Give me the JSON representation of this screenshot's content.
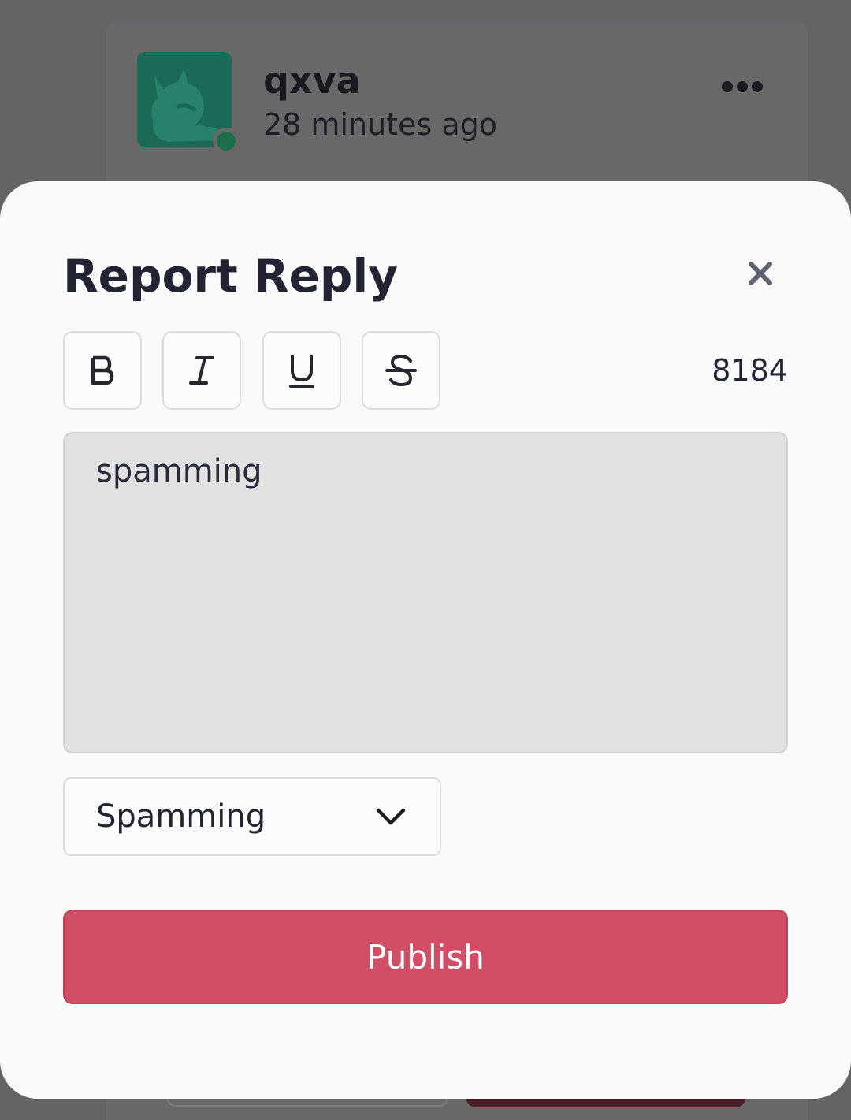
{
  "post": {
    "author": "qxva",
    "time": "28 minutes ago",
    "avatar_icon": "cat-avatar-icon",
    "more_icon": "more-horizontal-icon"
  },
  "modal": {
    "title": "Report Reply",
    "close_icon": "close-icon",
    "toolbar": {
      "buttons": [
        {
          "name": "bold",
          "icon": "bold-icon"
        },
        {
          "name": "italic",
          "icon": "italic-icon"
        },
        {
          "name": "underline",
          "icon": "underline-icon"
        },
        {
          "name": "strikethrough",
          "icon": "strikethrough-icon"
        }
      ],
      "char_count": "8184"
    },
    "textarea_value": "spamming",
    "reason_select": {
      "selected": "Spamming",
      "icon": "chevron-down-icon"
    },
    "publish_label": "Publish"
  },
  "colors": {
    "overlay": "#646466",
    "modal_bg": "#fafafa",
    "publish_button": "#d24e67",
    "online_status": "#1d6e4c"
  }
}
